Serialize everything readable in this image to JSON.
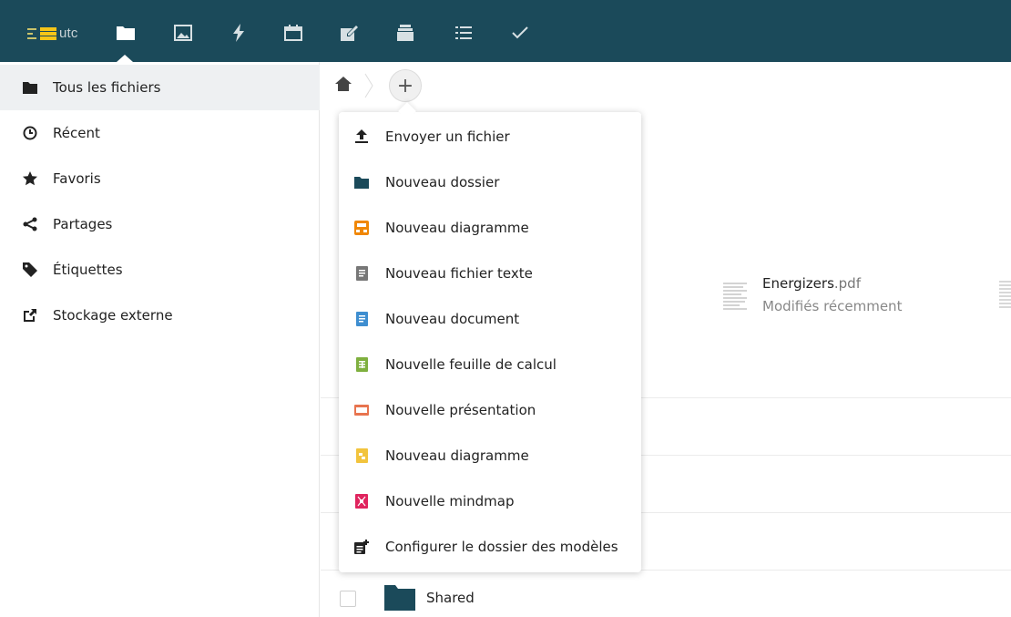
{
  "header": {
    "logo_text": "utc",
    "apps": [
      "files-icon",
      "photos-icon",
      "activity-icon",
      "calendar-icon",
      "notes-icon",
      "deck-icon",
      "tasks-icon",
      "checkmark-icon"
    ],
    "background": "#1b4a5a"
  },
  "sidebar": {
    "items": [
      {
        "label": "Tous les fichiers",
        "icon": "folder-icon",
        "active": true
      },
      {
        "label": "Récent",
        "icon": "clock-icon"
      },
      {
        "label": "Favoris",
        "icon": "star-icon"
      },
      {
        "label": "Partages",
        "icon": "share-icon"
      },
      {
        "label": "Étiquettes",
        "icon": "tag-icon"
      },
      {
        "label": "Stockage externe",
        "icon": "external-link-icon"
      }
    ]
  },
  "breadcrumb": {
    "home_icon": "home-icon",
    "add_label": "+"
  },
  "new_menu": {
    "items": [
      {
        "label": "Envoyer un fichier",
        "icon": "upload-icon"
      },
      {
        "label": "Nouveau dossier",
        "icon": "folder-icon",
        "color": "#1b4a5a"
      },
      {
        "label": "Nouveau diagramme",
        "icon": "drawio-icon",
        "color": "#f08705"
      },
      {
        "label": "Nouveau fichier texte",
        "icon": "text-file-icon",
        "color": "#777777"
      },
      {
        "label": "Nouveau document",
        "icon": "document-icon",
        "color": "#3e8ed0"
      },
      {
        "label": "Nouvelle feuille de calcul",
        "icon": "spreadsheet-icon",
        "color": "#7fb03f"
      },
      {
        "label": "Nouvelle présentation",
        "icon": "presentation-icon",
        "color": "#e8744f"
      },
      {
        "label": "Nouveau diagramme",
        "icon": "diagram-icon",
        "color": "#f2c43d"
      },
      {
        "label": "Nouvelle mindmap",
        "icon": "mindmap-icon",
        "color": "#e0245e"
      },
      {
        "label": "Configurer le dossier des modèles",
        "icon": "template-icon"
      }
    ]
  },
  "recent_file": {
    "name": "Energizers",
    "ext": ".pdf",
    "subtitle": "Modifiés récemment"
  },
  "files": [
    {
      "name": "Shared",
      "icon": "folder-icon"
    }
  ]
}
